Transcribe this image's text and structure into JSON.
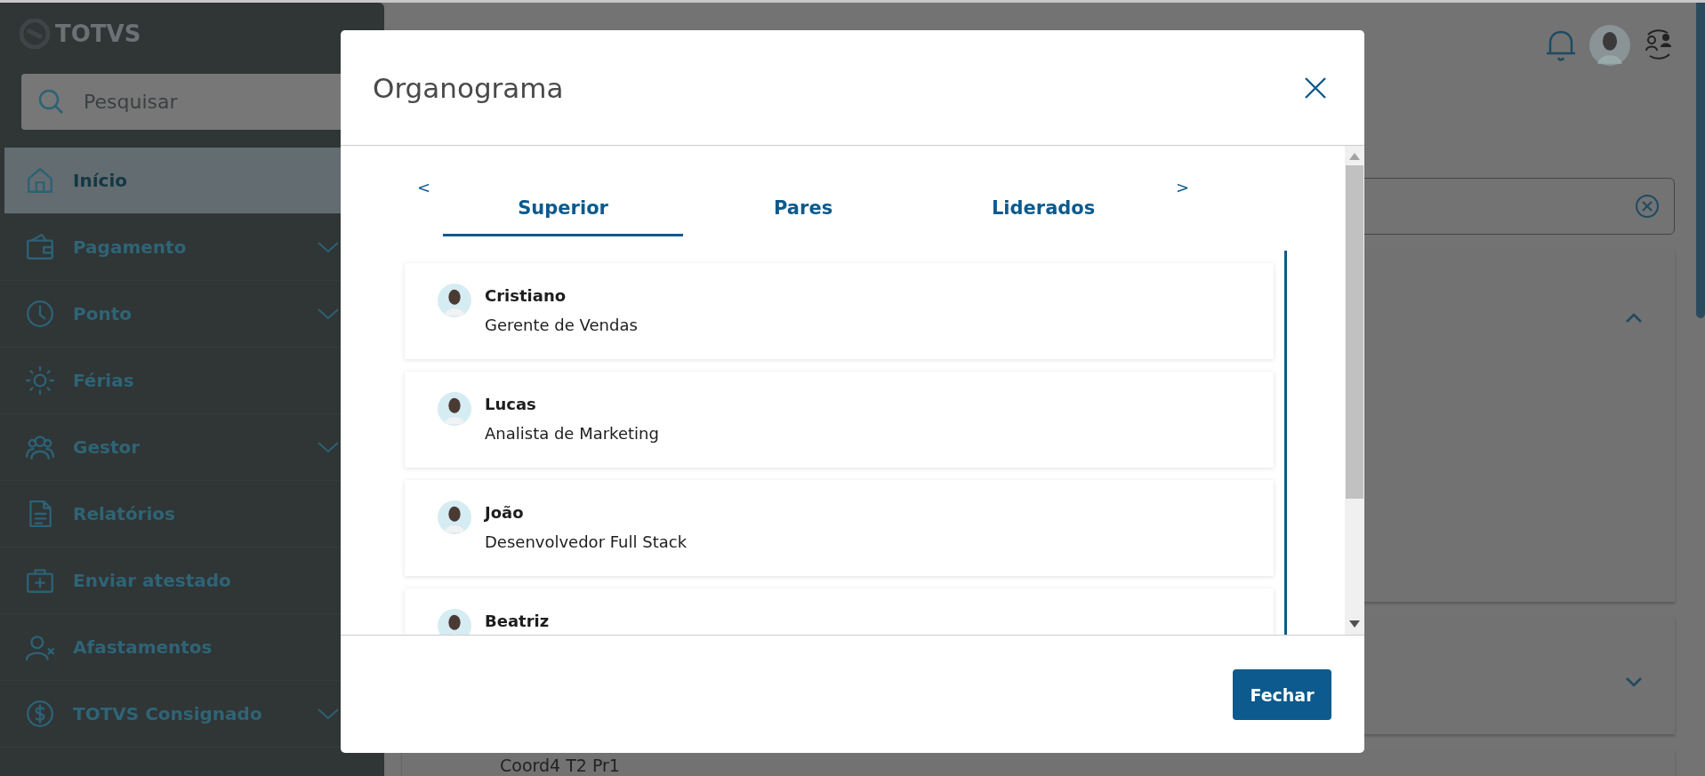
{
  "sidebar": {
    "logo": "TOTVS",
    "search": {
      "placeholder": "Pesquisar"
    },
    "items": [
      {
        "kind": "home",
        "label": "Início",
        "selected": true,
        "expandable": false
      },
      {
        "kind": "wallet",
        "label": "Pagamento",
        "selected": false,
        "expandable": true
      },
      {
        "kind": "clock",
        "label": "Ponto",
        "selected": false,
        "expandable": true
      },
      {
        "kind": "sun",
        "label": "Férias",
        "selected": false,
        "expandable": false
      },
      {
        "kind": "people",
        "label": "Gestor",
        "selected": false,
        "expandable": true
      },
      {
        "kind": "document",
        "label": "Relatórios",
        "selected": false,
        "expandable": false
      },
      {
        "kind": "medkit",
        "label": "Enviar atestado",
        "selected": false,
        "expandable": false
      },
      {
        "kind": "user-x",
        "label": "Afastamentos",
        "selected": false,
        "expandable": false
      },
      {
        "kind": "dollar",
        "label": "TOTVS Consignado",
        "selected": false,
        "expandable": true
      }
    ]
  },
  "main": {
    "cards": [
      {
        "expanded": true
      },
      {
        "expanded": false
      },
      {
        "text": "Coord4 T2 Pr1"
      }
    ]
  },
  "dialog": {
    "title": "Organograma",
    "prev": "<",
    "next": ">",
    "tabs": [
      {
        "label": "Superior",
        "selected": true
      },
      {
        "label": "Pares",
        "selected": false
      },
      {
        "label": "Liderados",
        "selected": false
      }
    ],
    "people": [
      {
        "name": "Cristiano",
        "role": "Gerente de Vendas"
      },
      {
        "name": "Lucas",
        "role": "Analista de Marketing"
      },
      {
        "name": "João",
        "role": "Desenvolvedor Full Stack"
      },
      {
        "name": "Beatriz"
      }
    ],
    "buttons": [
      "Fechar"
    ]
  }
}
